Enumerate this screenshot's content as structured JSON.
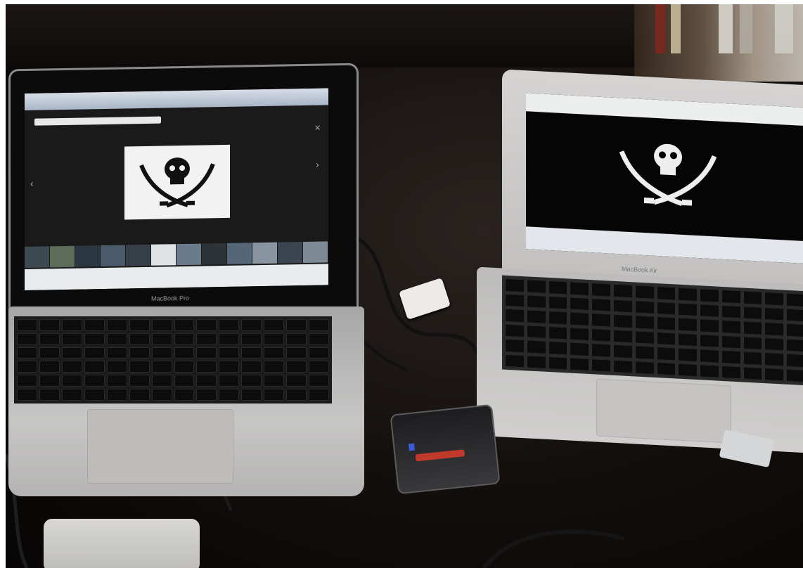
{
  "scene": {
    "description_kind": "photo of two laptops on a dark desk",
    "colors": {
      "desk": "#120e0c",
      "aluminum": "#c6c5c4",
      "keys": "#0c0c0d",
      "screen_black": "#050505",
      "flag_white": "#f2f2f2"
    }
  },
  "left_laptop": {
    "brand_label": "MacBook Pro",
    "screen": {
      "content": "image gallery showing pirate flag",
      "icons": [
        "skull-crossed-swords-icon",
        "chevron-left-icon",
        "chevron-right-icon",
        "close-icon"
      ]
    }
  },
  "right_laptop": {
    "brand_label": "MacBook Air",
    "screen": {
      "content": "fullscreen pirate flag",
      "icons": [
        "skull-crossed-swords-icon"
      ]
    }
  }
}
